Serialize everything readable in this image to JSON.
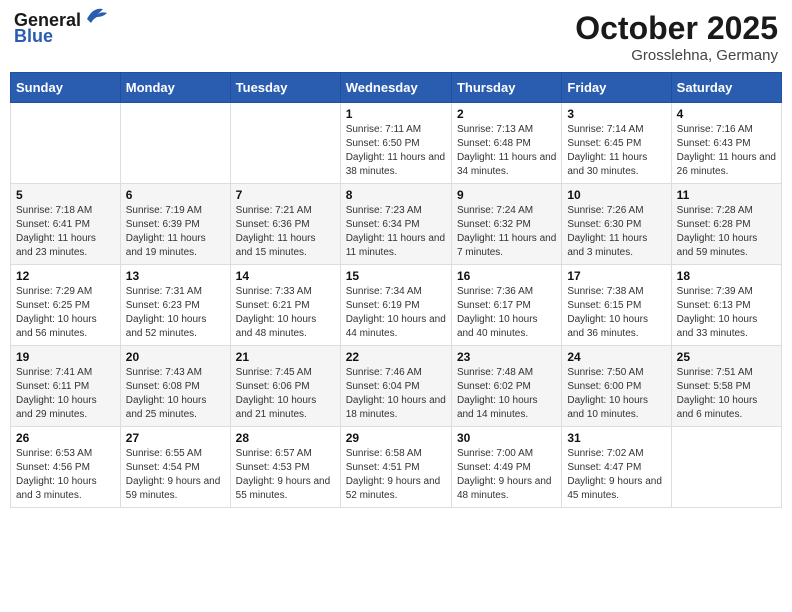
{
  "header": {
    "logo_line1": "General",
    "logo_line2": "Blue",
    "month_title": "October 2025",
    "location": "Grosslehna, Germany"
  },
  "weekdays": [
    "Sunday",
    "Monday",
    "Tuesday",
    "Wednesday",
    "Thursday",
    "Friday",
    "Saturday"
  ],
  "weeks": [
    [
      {
        "day": "",
        "sunrise": "",
        "sunset": "",
        "daylight": ""
      },
      {
        "day": "",
        "sunrise": "",
        "sunset": "",
        "daylight": ""
      },
      {
        "day": "",
        "sunrise": "",
        "sunset": "",
        "daylight": ""
      },
      {
        "day": "1",
        "sunrise": "Sunrise: 7:11 AM",
        "sunset": "Sunset: 6:50 PM",
        "daylight": "Daylight: 11 hours and 38 minutes."
      },
      {
        "day": "2",
        "sunrise": "Sunrise: 7:13 AM",
        "sunset": "Sunset: 6:48 PM",
        "daylight": "Daylight: 11 hours and 34 minutes."
      },
      {
        "day": "3",
        "sunrise": "Sunrise: 7:14 AM",
        "sunset": "Sunset: 6:45 PM",
        "daylight": "Daylight: 11 hours and 30 minutes."
      },
      {
        "day": "4",
        "sunrise": "Sunrise: 7:16 AM",
        "sunset": "Sunset: 6:43 PM",
        "daylight": "Daylight: 11 hours and 26 minutes."
      }
    ],
    [
      {
        "day": "5",
        "sunrise": "Sunrise: 7:18 AM",
        "sunset": "Sunset: 6:41 PM",
        "daylight": "Daylight: 11 hours and 23 minutes."
      },
      {
        "day": "6",
        "sunrise": "Sunrise: 7:19 AM",
        "sunset": "Sunset: 6:39 PM",
        "daylight": "Daylight: 11 hours and 19 minutes."
      },
      {
        "day": "7",
        "sunrise": "Sunrise: 7:21 AM",
        "sunset": "Sunset: 6:36 PM",
        "daylight": "Daylight: 11 hours and 15 minutes."
      },
      {
        "day": "8",
        "sunrise": "Sunrise: 7:23 AM",
        "sunset": "Sunset: 6:34 PM",
        "daylight": "Daylight: 11 hours and 11 minutes."
      },
      {
        "day": "9",
        "sunrise": "Sunrise: 7:24 AM",
        "sunset": "Sunset: 6:32 PM",
        "daylight": "Daylight: 11 hours and 7 minutes."
      },
      {
        "day": "10",
        "sunrise": "Sunrise: 7:26 AM",
        "sunset": "Sunset: 6:30 PM",
        "daylight": "Daylight: 11 hours and 3 minutes."
      },
      {
        "day": "11",
        "sunrise": "Sunrise: 7:28 AM",
        "sunset": "Sunset: 6:28 PM",
        "daylight": "Daylight: 10 hours and 59 minutes."
      }
    ],
    [
      {
        "day": "12",
        "sunrise": "Sunrise: 7:29 AM",
        "sunset": "Sunset: 6:25 PM",
        "daylight": "Daylight: 10 hours and 56 minutes."
      },
      {
        "day": "13",
        "sunrise": "Sunrise: 7:31 AM",
        "sunset": "Sunset: 6:23 PM",
        "daylight": "Daylight: 10 hours and 52 minutes."
      },
      {
        "day": "14",
        "sunrise": "Sunrise: 7:33 AM",
        "sunset": "Sunset: 6:21 PM",
        "daylight": "Daylight: 10 hours and 48 minutes."
      },
      {
        "day": "15",
        "sunrise": "Sunrise: 7:34 AM",
        "sunset": "Sunset: 6:19 PM",
        "daylight": "Daylight: 10 hours and 44 minutes."
      },
      {
        "day": "16",
        "sunrise": "Sunrise: 7:36 AM",
        "sunset": "Sunset: 6:17 PM",
        "daylight": "Daylight: 10 hours and 40 minutes."
      },
      {
        "day": "17",
        "sunrise": "Sunrise: 7:38 AM",
        "sunset": "Sunset: 6:15 PM",
        "daylight": "Daylight: 10 hours and 36 minutes."
      },
      {
        "day": "18",
        "sunrise": "Sunrise: 7:39 AM",
        "sunset": "Sunset: 6:13 PM",
        "daylight": "Daylight: 10 hours and 33 minutes."
      }
    ],
    [
      {
        "day": "19",
        "sunrise": "Sunrise: 7:41 AM",
        "sunset": "Sunset: 6:11 PM",
        "daylight": "Daylight: 10 hours and 29 minutes."
      },
      {
        "day": "20",
        "sunrise": "Sunrise: 7:43 AM",
        "sunset": "Sunset: 6:08 PM",
        "daylight": "Daylight: 10 hours and 25 minutes."
      },
      {
        "day": "21",
        "sunrise": "Sunrise: 7:45 AM",
        "sunset": "Sunset: 6:06 PM",
        "daylight": "Daylight: 10 hours and 21 minutes."
      },
      {
        "day": "22",
        "sunrise": "Sunrise: 7:46 AM",
        "sunset": "Sunset: 6:04 PM",
        "daylight": "Daylight: 10 hours and 18 minutes."
      },
      {
        "day": "23",
        "sunrise": "Sunrise: 7:48 AM",
        "sunset": "Sunset: 6:02 PM",
        "daylight": "Daylight: 10 hours and 14 minutes."
      },
      {
        "day": "24",
        "sunrise": "Sunrise: 7:50 AM",
        "sunset": "Sunset: 6:00 PM",
        "daylight": "Daylight: 10 hours and 10 minutes."
      },
      {
        "day": "25",
        "sunrise": "Sunrise: 7:51 AM",
        "sunset": "Sunset: 5:58 PM",
        "daylight": "Daylight: 10 hours and 6 minutes."
      }
    ],
    [
      {
        "day": "26",
        "sunrise": "Sunrise: 6:53 AM",
        "sunset": "Sunset: 4:56 PM",
        "daylight": "Daylight: 10 hours and 3 minutes."
      },
      {
        "day": "27",
        "sunrise": "Sunrise: 6:55 AM",
        "sunset": "Sunset: 4:54 PM",
        "daylight": "Daylight: 9 hours and 59 minutes."
      },
      {
        "day": "28",
        "sunrise": "Sunrise: 6:57 AM",
        "sunset": "Sunset: 4:53 PM",
        "daylight": "Daylight: 9 hours and 55 minutes."
      },
      {
        "day": "29",
        "sunrise": "Sunrise: 6:58 AM",
        "sunset": "Sunset: 4:51 PM",
        "daylight": "Daylight: 9 hours and 52 minutes."
      },
      {
        "day": "30",
        "sunrise": "Sunrise: 7:00 AM",
        "sunset": "Sunset: 4:49 PM",
        "daylight": "Daylight: 9 hours and 48 minutes."
      },
      {
        "day": "31",
        "sunrise": "Sunrise: 7:02 AM",
        "sunset": "Sunset: 4:47 PM",
        "daylight": "Daylight: 9 hours and 45 minutes."
      },
      {
        "day": "",
        "sunrise": "",
        "sunset": "",
        "daylight": ""
      }
    ]
  ]
}
